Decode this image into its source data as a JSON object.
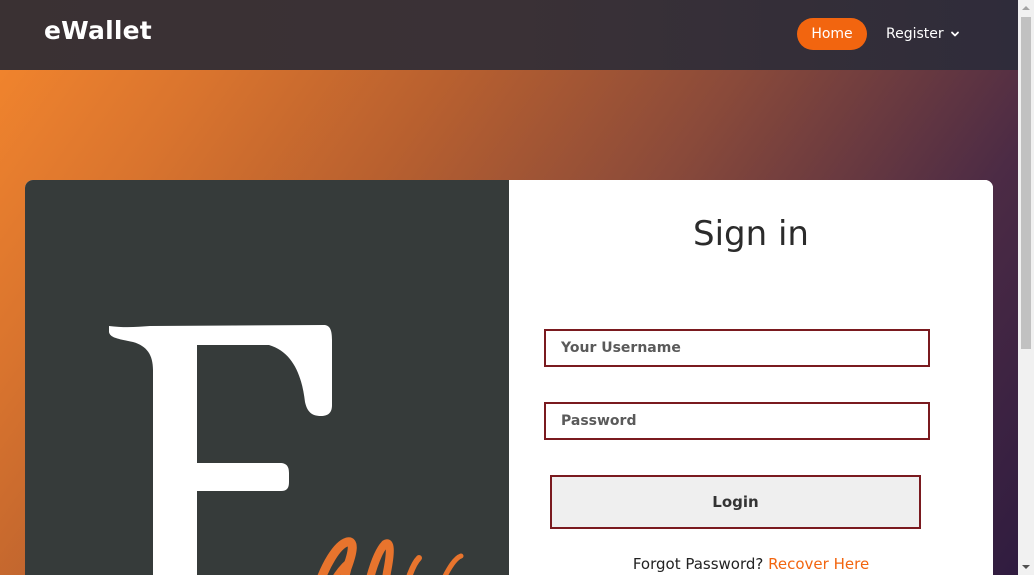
{
  "navbar": {
    "brand": "eWallet",
    "home_label": "Home",
    "register_label": "Register"
  },
  "form": {
    "title": "Sign in",
    "username_placeholder": "Your Username",
    "password_placeholder": "Password",
    "login_label": "Login",
    "forgot_text": "Forgot Password?",
    "recover_link": "Recover Here"
  },
  "colors": {
    "accent": "#f2650f",
    "input_border": "#7a1a1f",
    "panel_dark": "#363b3a",
    "navbar": "#3a3133"
  },
  "icons": {
    "register_dropdown": "chevron-down-icon",
    "scroll_up": "scroll-up-arrow-icon",
    "scroll_down": "scroll-down-arrow-icon"
  }
}
